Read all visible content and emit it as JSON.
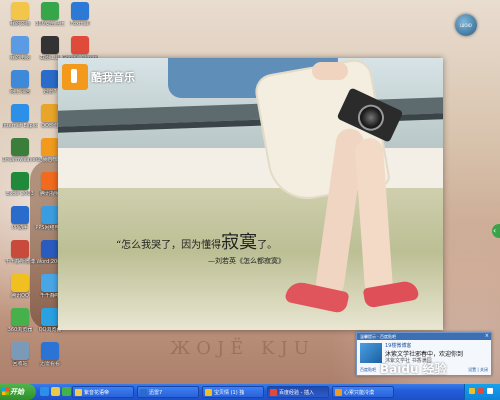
{
  "desktop": {
    "wallpaper_text": "ЖOJЁ  KJU",
    "icons": [
      {
        "label": "我的文档",
        "color": "#f3c64a"
      },
      {
        "label": "360安全卫士",
        "color": "#37a64a"
      },
      {
        "label": "Foxmail",
        "color": "#2c7ad6"
      },
      {
        "label": "我的电脑",
        "color": "#5b9be3"
      },
      {
        "label": "截图工具",
        "color": "#333333"
      },
      {
        "label": "Google Chrome",
        "color": "#e04a3a"
      },
      {
        "label": "网上邻居",
        "color": "#3f8ad8"
      },
      {
        "label": "迅雷7",
        "color": "#2a6ccb"
      },
      {
        "label": "Internet Explorer",
        "color": "#2c8fe8"
      },
      {
        "label": "QQ影音",
        "color": "#e8a52a"
      },
      {
        "label": "酷我音乐盒",
        "color": "#f29a1d"
      },
      {
        "label": "Dreamweaver",
        "color": "#3b7d3b"
      },
      {
        "label": "Excel 2003",
        "color": "#1f8a3a"
      },
      {
        "label": "腾讯视频",
        "color": "#f26a1d"
      },
      {
        "label": "PPS网络电视",
        "color": "#3a9de0"
      },
      {
        "label": "PP助手",
        "color": "#2a6ccb"
      },
      {
        "label": "Word 2003",
        "color": "#2a5bbf"
      },
      {
        "label": "千千静听",
        "color": "#49a6e6"
      },
      {
        "label": "千千静听微博",
        "color": "#c84a3a"
      },
      {
        "label": "QQ浏览器",
        "color": "#2aa1e0"
      },
      {
        "label": "腾讯QQ",
        "color": "#f0c020"
      },
      {
        "label": "阿里旺旺",
        "color": "#f07a1a"
      },
      {
        "label": "360浏览器",
        "color": "#46b04a"
      },
      {
        "label": "回收站",
        "color": "#7a9ab8"
      },
      {
        "label": "迅雷看看",
        "color": "#2b74d6"
      }
    ],
    "float_widget": "ШОЮ"
  },
  "player": {
    "app_name": "酷我音乐",
    "quote_line1_a": "“怎么我哭了，因为懂得",
    "quote_big": "寂寞",
    "quote_line1_b": "了。",
    "quote_line2": "—刘若英《怎么都寂寞》"
  },
  "notification": {
    "header": "温馨提示 - 百度贴吧",
    "title": "19楼微博客",
    "message": "沐紫文学社邪春中，欢迎你到",
    "sub": "沐紫文学社 书香满园",
    "footer": "百度贴吧",
    "settings": "设置 | 关闭",
    "close": "×"
  },
  "watermark": "Baidu 经验",
  "taskbar": {
    "start_label": "开始",
    "tasks": [
      {
        "label": "紫音花语帝",
        "icon_color": "#f2c94a",
        "active": false
      },
      {
        "label": "迅雷7",
        "icon_color": "#2a6ccb",
        "active": false
      },
      {
        "label": "宝贝情 (1) 独",
        "icon_color": "#f0c020",
        "active": false
      },
      {
        "label": "百度经验 - 插入",
        "icon_color": "#e04a3a",
        "active": true
      },
      {
        "label": "心累只能冷漠",
        "icon_color": "#f29a1d",
        "active": false
      }
    ]
  },
  "colors": {
    "taskbar_blue": "#245edb",
    "start_green": "#3a9d35",
    "player_accent": "#f39a1d"
  }
}
